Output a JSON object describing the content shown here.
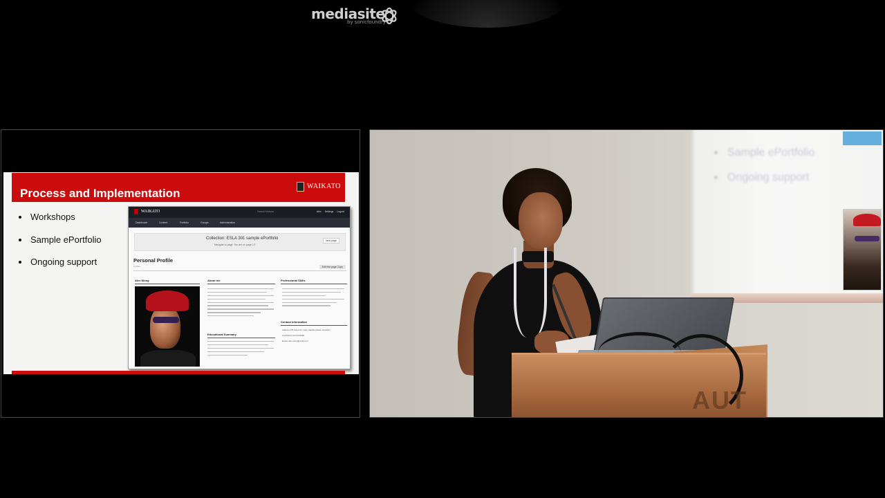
{
  "player": {
    "brand": "mediasite",
    "brand_byline": "by sonicfoundry"
  },
  "slide": {
    "title": "Process and Implementation",
    "logo_text": "WAIKATO",
    "bullets": [
      "Workshops",
      "Sample ePortfolio",
      "Ongoing support"
    ]
  },
  "eportfolio": {
    "brand": "WAIKATO",
    "search_placeholder": "Search Mahara",
    "top_links": [
      "Alex",
      "Settings",
      "Logout"
    ],
    "nav": [
      "Dashboard",
      "Content",
      "Portfolio",
      "Groups",
      "Administration"
    ],
    "collection_title": "Collection: ESLA 301 sample ePortfolio",
    "navigate_label": "Navigate to page:",
    "page_select": "You are on page 1/7",
    "next_page": "Next page",
    "page_heading": "Personal Profile",
    "by_line": "by Alex",
    "edit_buttons": "Edit this page  Copy",
    "columns": {
      "col1": "Alex Wong",
      "col2": "About me",
      "col3": "Professional Skills",
      "col2b": "Educational Summary",
      "col3b": "Contact Information"
    },
    "contact": [
      "Address 4/5 Cameron road, Hamilton East, Hamilton",
      "Cell Phone 0271234982",
      "Email: alex.wong@mail.com"
    ]
  },
  "video": {
    "ghost_bullets": [
      "Sample ePortfolio",
      "Ongoing support"
    ],
    "lectern_text": "AUT"
  },
  "colors": {
    "accent_red": "#cc0c0c",
    "background": "#000000"
  }
}
